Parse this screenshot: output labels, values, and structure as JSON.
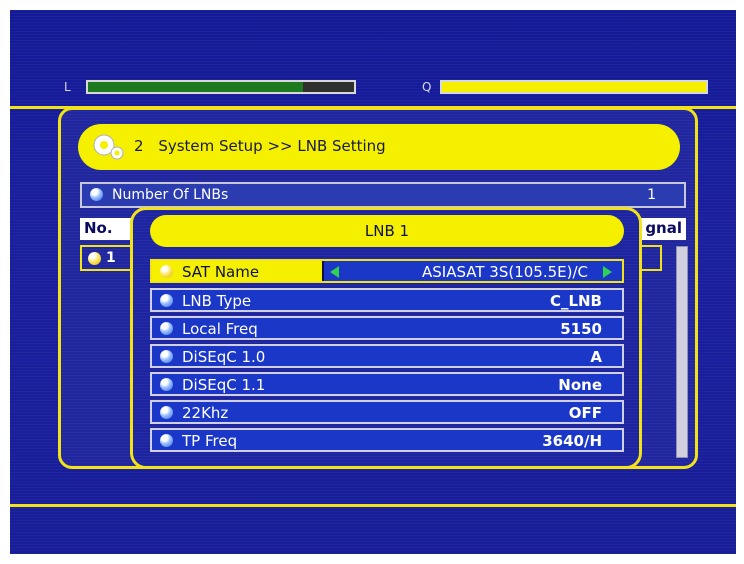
{
  "signal_meters": {
    "level": {
      "letter": "L",
      "fill_percent": 81,
      "fill_color": "#1e7a1e"
    },
    "quality": {
      "letter": "Q",
      "fill_percent": 100,
      "fill_color": "#f4f000"
    }
  },
  "header": {
    "icon": "gear-icon",
    "menu_number": "2",
    "breadcrumb": "System Setup >> LNB Setting"
  },
  "settings": {
    "number_of_lnbs_label": "Number Of LNBs",
    "number_of_lnbs_value": "1"
  },
  "table": {
    "col_no": "No.",
    "col_signal": "gnal",
    "rows": [
      {
        "no": "1"
      }
    ]
  },
  "popup": {
    "title": "LNB 1",
    "rows": [
      {
        "label": "SAT Name",
        "value": "ASIASAT 3S(105.5E)/C",
        "selected": true
      },
      {
        "label": "LNB Type",
        "value": "C_LNB"
      },
      {
        "label": "Local Freq",
        "value": "5150"
      },
      {
        "label": "DiSEqC 1.0",
        "value": "A"
      },
      {
        "label": "DiSEqC 1.1",
        "value": "None"
      },
      {
        "label": "22Khz",
        "value": "OFF"
      },
      {
        "label": "TP Freq",
        "value": "3640/H"
      }
    ]
  },
  "colors": {
    "background": "#1a1f9e",
    "accent_yellow": "#f4f000",
    "row_blue": "#1b37c8"
  }
}
